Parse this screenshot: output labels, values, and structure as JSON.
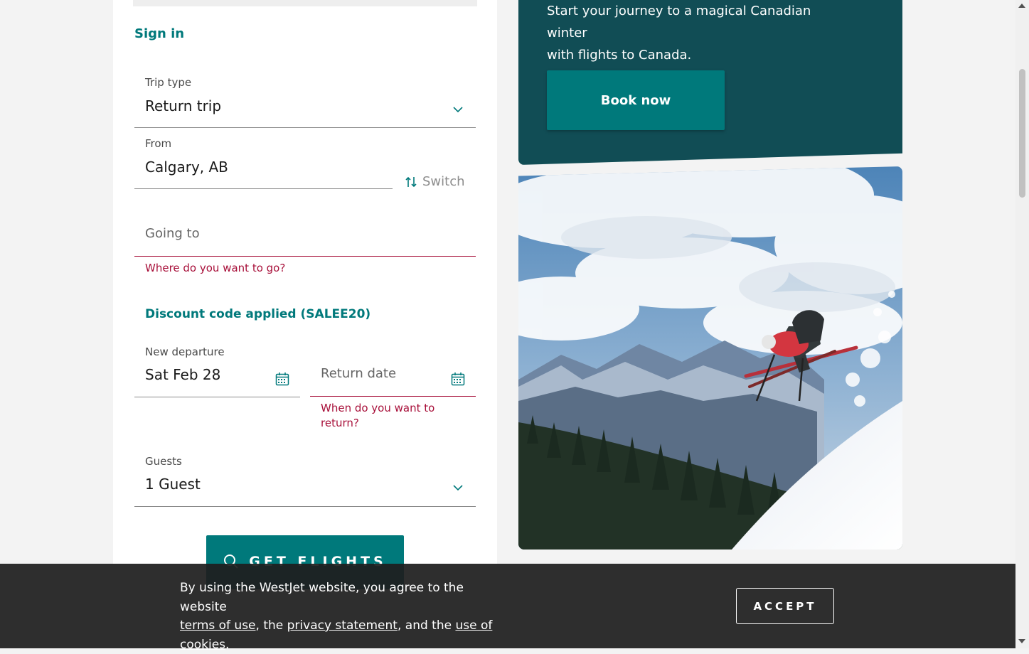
{
  "form": {
    "sign_in": "Sign in",
    "trip_type": {
      "label": "Trip type",
      "value": "Return trip"
    },
    "from": {
      "label": "From",
      "value": "Calgary, AB"
    },
    "switch_label": "Switch",
    "going_to": {
      "placeholder": "Going to",
      "error": "Where do you want to go?"
    },
    "discount": "Discount code applied (SALEE20)",
    "departure": {
      "label": "New departure",
      "value": "Sat Feb 28"
    },
    "return_date": {
      "placeholder": "Return date",
      "error_line1": "When do you want to",
      "error_line2": "return?"
    },
    "guests": {
      "label": "Guests",
      "value": "1 Guest"
    },
    "submit_label": "GET FLIGHTS"
  },
  "promo": {
    "line1": "Start your journey to a magical Canadian winter",
    "line2": "with flights to Canada.",
    "book_label": "Book now"
  },
  "cookie": {
    "text_before": "By using the WestJet website, you agree to the website",
    "terms_link": "terms of use",
    "sep1": ", the ",
    "privacy_link": "privacy statement",
    "sep2": ", and the ",
    "cookies_link_1": "use of",
    "cookies_link_2": "cookies",
    "end": ".",
    "accept_label": "ACCEPT"
  },
  "colors": {
    "brand_teal": "#00797b",
    "promo_bg": "#114d55",
    "error": "#a8103a"
  },
  "icons": {
    "dropdown": "chevron-down-icon",
    "switch": "swap-arrows-icon",
    "calendar": "calendar-icon",
    "search": "search-icon"
  }
}
